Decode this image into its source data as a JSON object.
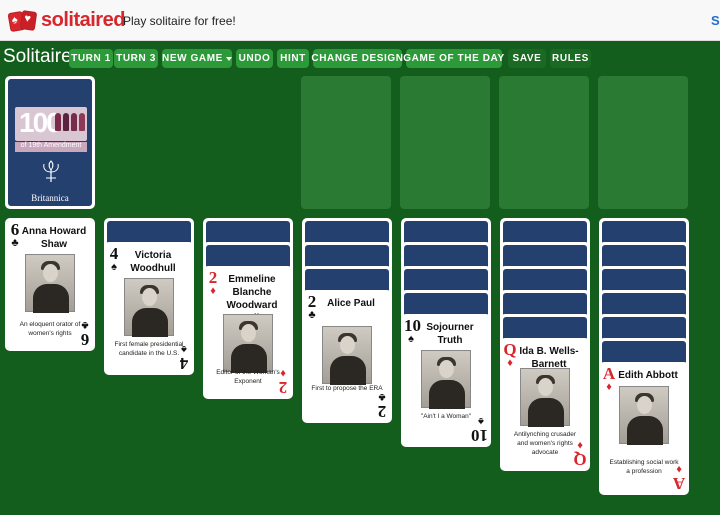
{
  "site": {
    "logo_text": "solitaired",
    "tagline": "Play solitaire for free!",
    "login_partial": "S"
  },
  "toolbar": {
    "title": "Solitaire",
    "buttons": [
      {
        "label": "TURN 1"
      },
      {
        "label": "TURN 3"
      },
      {
        "label": "NEW GAME"
      },
      {
        "label": "UNDO"
      },
      {
        "label": "HINT"
      },
      {
        "label": "CHANGE DESIGN"
      },
      {
        "label": "GAME OF THE DAY"
      },
      {
        "label": "SAVE"
      },
      {
        "label": "RULES"
      }
    ]
  },
  "stock": {
    "banner_number": "100",
    "banner_subtitle": "of 19th Amendment",
    "brand": "Britannica"
  },
  "colors": {
    "felt": "#135e1c",
    "button": "#2d9a3a",
    "card_back": "#24406e",
    "red_suit": "#d8262d"
  },
  "tableau": [
    {
      "rank": "6",
      "suit": "♣",
      "color": "black",
      "name": "Anna Howard Shaw",
      "caption": "An eloquent orator of women's rights",
      "hidden": 0
    },
    {
      "rank": "4",
      "suit": "♠",
      "color": "black",
      "name": "Victoria Woodhull",
      "caption": "First female presidential candidate in the U.S.",
      "hidden": 1
    },
    {
      "rank": "2",
      "suit": "♦",
      "color": "red",
      "name": "Emmeline Blanche Woodward Wells",
      "caption": "Editor of the Woman's Exponent",
      "hidden": 2
    },
    {
      "rank": "2",
      "suit": "♣",
      "color": "black",
      "name": "Alice Paul",
      "caption": "First to propose the ERA",
      "hidden": 3
    },
    {
      "rank": "10",
      "suit": "♠",
      "color": "black",
      "name": "Sojourner Truth",
      "caption": "\"Ain't I a Woman\"",
      "hidden": 4
    },
    {
      "rank": "Q",
      "suit": "♦",
      "color": "red",
      "name": "Ida B. Wells-Barnett",
      "caption": "Antilynching crusader and women's rights advocate",
      "hidden": 5
    },
    {
      "rank": "A",
      "suit": "♦",
      "color": "red",
      "name": "Edith Abbott",
      "caption": "Establishing social work a profession",
      "hidden": 6
    }
  ]
}
